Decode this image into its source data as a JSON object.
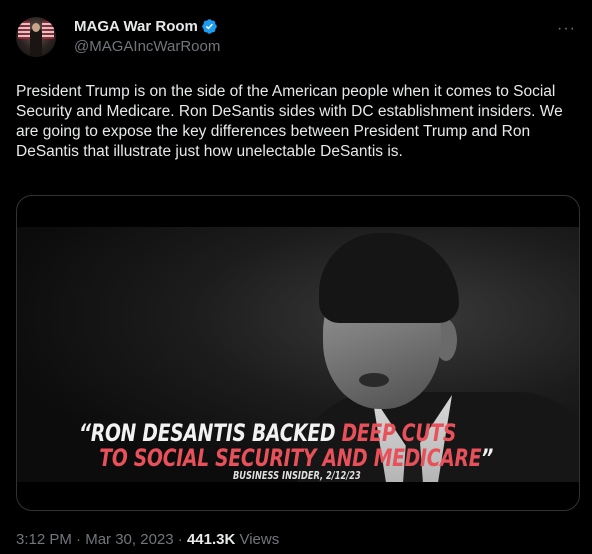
{
  "author": {
    "display_name": "MAGA War Room",
    "handle": "@MAGAIncWarRoom",
    "verified": true,
    "badge_color": "#1d9bf0"
  },
  "tweet": {
    "text": "President Trump is on the side of the American people when it comes to Social Security and Medicare. Ron DeSantis sides with DC establishment insiders. We are going to expose the key differences between President Trump and Ron DeSantis that illustrate just how unelectable DeSantis is."
  },
  "media": {
    "caption_white": "“RON DESANTIS BACKED ",
    "caption_red_1": "DEEP CUTS",
    "caption_red_2": "TO SOCIAL SECURITY AND MEDICARE",
    "caption_close_quote": "”",
    "caption_source": "BUSINESS INSIDER, 2/12/23",
    "caption_red_color": "#e8505a"
  },
  "meta": {
    "time": "3:12 PM",
    "sep1": " · ",
    "date": "Mar 30, 2023",
    "sep2": " · ",
    "views_count": "441.3K",
    "views_label": " Views"
  },
  "menu": {
    "more_icon": "···"
  }
}
